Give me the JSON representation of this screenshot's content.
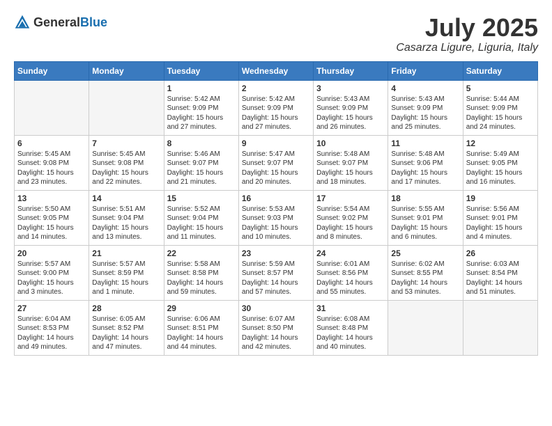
{
  "header": {
    "logo": {
      "general": "General",
      "blue": "Blue"
    },
    "title": "July 2025",
    "location": "Casarza Ligure, Liguria, Italy"
  },
  "days_of_week": [
    "Sunday",
    "Monday",
    "Tuesday",
    "Wednesday",
    "Thursday",
    "Friday",
    "Saturday"
  ],
  "weeks": [
    [
      {
        "day": null,
        "info": null
      },
      {
        "day": null,
        "info": null
      },
      {
        "day": "1",
        "info": "Sunrise: 5:42 AM\nSunset: 9:09 PM\nDaylight: 15 hours\nand 27 minutes."
      },
      {
        "day": "2",
        "info": "Sunrise: 5:42 AM\nSunset: 9:09 PM\nDaylight: 15 hours\nand 27 minutes."
      },
      {
        "day": "3",
        "info": "Sunrise: 5:43 AM\nSunset: 9:09 PM\nDaylight: 15 hours\nand 26 minutes."
      },
      {
        "day": "4",
        "info": "Sunrise: 5:43 AM\nSunset: 9:09 PM\nDaylight: 15 hours\nand 25 minutes."
      },
      {
        "day": "5",
        "info": "Sunrise: 5:44 AM\nSunset: 9:09 PM\nDaylight: 15 hours\nand 24 minutes."
      }
    ],
    [
      {
        "day": "6",
        "info": "Sunrise: 5:45 AM\nSunset: 9:08 PM\nDaylight: 15 hours\nand 23 minutes."
      },
      {
        "day": "7",
        "info": "Sunrise: 5:45 AM\nSunset: 9:08 PM\nDaylight: 15 hours\nand 22 minutes."
      },
      {
        "day": "8",
        "info": "Sunrise: 5:46 AM\nSunset: 9:07 PM\nDaylight: 15 hours\nand 21 minutes."
      },
      {
        "day": "9",
        "info": "Sunrise: 5:47 AM\nSunset: 9:07 PM\nDaylight: 15 hours\nand 20 minutes."
      },
      {
        "day": "10",
        "info": "Sunrise: 5:48 AM\nSunset: 9:07 PM\nDaylight: 15 hours\nand 18 minutes."
      },
      {
        "day": "11",
        "info": "Sunrise: 5:48 AM\nSunset: 9:06 PM\nDaylight: 15 hours\nand 17 minutes."
      },
      {
        "day": "12",
        "info": "Sunrise: 5:49 AM\nSunset: 9:05 PM\nDaylight: 15 hours\nand 16 minutes."
      }
    ],
    [
      {
        "day": "13",
        "info": "Sunrise: 5:50 AM\nSunset: 9:05 PM\nDaylight: 15 hours\nand 14 minutes."
      },
      {
        "day": "14",
        "info": "Sunrise: 5:51 AM\nSunset: 9:04 PM\nDaylight: 15 hours\nand 13 minutes."
      },
      {
        "day": "15",
        "info": "Sunrise: 5:52 AM\nSunset: 9:04 PM\nDaylight: 15 hours\nand 11 minutes."
      },
      {
        "day": "16",
        "info": "Sunrise: 5:53 AM\nSunset: 9:03 PM\nDaylight: 15 hours\nand 10 minutes."
      },
      {
        "day": "17",
        "info": "Sunrise: 5:54 AM\nSunset: 9:02 PM\nDaylight: 15 hours\nand 8 minutes."
      },
      {
        "day": "18",
        "info": "Sunrise: 5:55 AM\nSunset: 9:01 PM\nDaylight: 15 hours\nand 6 minutes."
      },
      {
        "day": "19",
        "info": "Sunrise: 5:56 AM\nSunset: 9:01 PM\nDaylight: 15 hours\nand 4 minutes."
      }
    ],
    [
      {
        "day": "20",
        "info": "Sunrise: 5:57 AM\nSunset: 9:00 PM\nDaylight: 15 hours\nand 3 minutes."
      },
      {
        "day": "21",
        "info": "Sunrise: 5:57 AM\nSunset: 8:59 PM\nDaylight: 15 hours\nand 1 minute."
      },
      {
        "day": "22",
        "info": "Sunrise: 5:58 AM\nSunset: 8:58 PM\nDaylight: 14 hours\nand 59 minutes."
      },
      {
        "day": "23",
        "info": "Sunrise: 5:59 AM\nSunset: 8:57 PM\nDaylight: 14 hours\nand 57 minutes."
      },
      {
        "day": "24",
        "info": "Sunrise: 6:01 AM\nSunset: 8:56 PM\nDaylight: 14 hours\nand 55 minutes."
      },
      {
        "day": "25",
        "info": "Sunrise: 6:02 AM\nSunset: 8:55 PM\nDaylight: 14 hours\nand 53 minutes."
      },
      {
        "day": "26",
        "info": "Sunrise: 6:03 AM\nSunset: 8:54 PM\nDaylight: 14 hours\nand 51 minutes."
      }
    ],
    [
      {
        "day": "27",
        "info": "Sunrise: 6:04 AM\nSunset: 8:53 PM\nDaylight: 14 hours\nand 49 minutes."
      },
      {
        "day": "28",
        "info": "Sunrise: 6:05 AM\nSunset: 8:52 PM\nDaylight: 14 hours\nand 47 minutes."
      },
      {
        "day": "29",
        "info": "Sunrise: 6:06 AM\nSunset: 8:51 PM\nDaylight: 14 hours\nand 44 minutes."
      },
      {
        "day": "30",
        "info": "Sunrise: 6:07 AM\nSunset: 8:50 PM\nDaylight: 14 hours\nand 42 minutes."
      },
      {
        "day": "31",
        "info": "Sunrise: 6:08 AM\nSunset: 8:48 PM\nDaylight: 14 hours\nand 40 minutes."
      },
      {
        "day": null,
        "info": null
      },
      {
        "day": null,
        "info": null
      }
    ]
  ]
}
